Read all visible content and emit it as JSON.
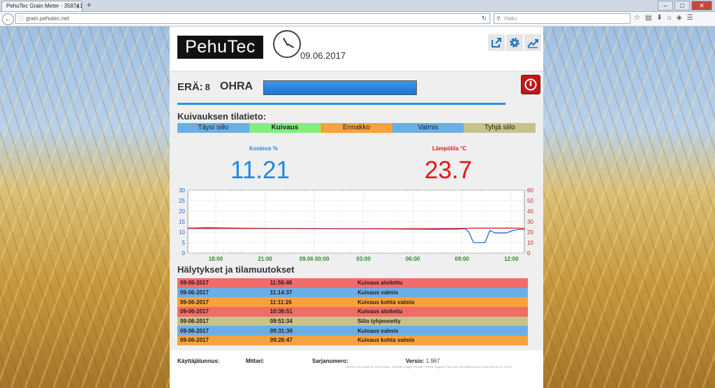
{
  "browser": {
    "tab_title": "PehuTec Grain Meter - 358741053",
    "tab_close": "x",
    "new_tab": "+",
    "url": "grain.pehutec.net",
    "search_placeholder": "Haku"
  },
  "header": {
    "logo": "PehuTec",
    "date": "09.06.2017"
  },
  "batch": {
    "label": "ERÄ:",
    "number": "8",
    "grain": "OHRA",
    "progress": 1.0
  },
  "status": {
    "title": "Kuivauksen tilatieto:",
    "items": [
      {
        "label": "Täysi siilo",
        "color": "#6aaee8",
        "active": false
      },
      {
        "label": "Kuivaus",
        "color": "#7ff07a",
        "active": true
      },
      {
        "label": "Ennakko",
        "color": "#f7a23e",
        "active": false
      },
      {
        "label": "Valmis",
        "color": "#6aaee8",
        "active": false
      },
      {
        "label": "Tyhjä siilo",
        "color": "#c6c28a",
        "active": false
      }
    ]
  },
  "measurements": {
    "moisture_label": "Kosteus %",
    "moisture_value": "11.21",
    "moisture_color": "#1e88e5",
    "temp_label": "Lämpötila °C",
    "temp_value": "23.7",
    "temp_color": "#e5141c"
  },
  "chart_data": {
    "type": "line",
    "x_tick_labels": [
      "18:00",
      "21:00",
      "09.06 00:00",
      "03:00",
      "06:00",
      "09:00",
      "12:00"
    ],
    "y_left_ticks": [
      "30",
      "25",
      "20",
      "15",
      "10",
      "5",
      "0"
    ],
    "y_right_ticks": [
      "60",
      "50",
      "40",
      "30",
      "20",
      "10",
      "0"
    ],
    "y_left_range": [
      0,
      30
    ],
    "y_right_range": [
      0,
      60
    ],
    "x_range_hours": [
      16.3,
      12.8
    ],
    "grid": true,
    "series": [
      {
        "axis": "left",
        "color": "#1e6fd0",
        "points": [
          [
            0,
            11.9
          ],
          [
            1.2,
            12.1
          ],
          [
            3,
            11.9
          ],
          [
            6,
            11.7
          ],
          [
            9,
            11.6
          ],
          [
            12,
            11.5
          ],
          [
            15,
            11.3
          ],
          [
            16.4,
            11.4
          ],
          [
            16.9,
            11.6
          ],
          [
            17.1,
            10.2
          ],
          [
            17.4,
            5
          ],
          [
            18.1,
            5
          ],
          [
            18.4,
            10.8
          ],
          [
            18.7,
            9.6
          ],
          [
            19.4,
            9.6
          ],
          [
            19.8,
            10.8
          ],
          [
            20.2,
            11.3
          ],
          [
            20.5,
            11.2
          ]
        ]
      },
      {
        "axis": "right",
        "color": "#d0282d",
        "points": [
          [
            0,
            23.5
          ],
          [
            4,
            23.5
          ],
          [
            8,
            23.3
          ],
          [
            12,
            23.2
          ],
          [
            15,
            23.3
          ],
          [
            16.4,
            23.5
          ],
          [
            16.9,
            23.6
          ],
          [
            17.4,
            23.8
          ],
          [
            18.5,
            23.8
          ],
          [
            19.5,
            23.8
          ],
          [
            20.5,
            23.7
          ]
        ]
      }
    ]
  },
  "alarms": {
    "title": "Hälytykset ja tilamuutokset",
    "rows": [
      {
        "date": "09-06-2017",
        "time": "11:56:46",
        "text": "Kuivaus aloitettu",
        "color": "#f26a6a"
      },
      {
        "date": "09-06-2017",
        "time": "11:14:37",
        "text": "Kuivaus valmis",
        "color": "#6aaee8"
      },
      {
        "date": "09-06-2017",
        "time": "11:11:26",
        "text": "Kuivaus kohta valmis",
        "color": "#f7a23e"
      },
      {
        "date": "09-06-2017",
        "time": "10:36:51",
        "text": "Kuivaus aloitettu",
        "color": "#f26a6a"
      },
      {
        "date": "09-06-2017",
        "time": "09:51:34",
        "text": "Siilo tyhjennetty",
        "color": "#c6c28a"
      },
      {
        "date": "09-06-2017",
        "time": "09:31:39",
        "text": "Kuivaus valmis",
        "color": "#6aaee8"
      },
      {
        "date": "09-06-2017",
        "time": "09:26:47",
        "text": "Kuivaus kohta valmis",
        "color": "#f7a23e"
      }
    ]
  },
  "footer": {
    "user_label": "Käyttäjätunnus:",
    "meter_label": "Mittari:",
    "serial_label": "Sarjanumero:",
    "version_label": "Versio:",
    "version_value": "1.967",
    "credit": "Header icons made by Victor Erixon, Tutsflow, Gregor Cresnar, Freepik, Bogdan Rosu from www.flaticon.com is licensed by CC 3.0 BY"
  }
}
